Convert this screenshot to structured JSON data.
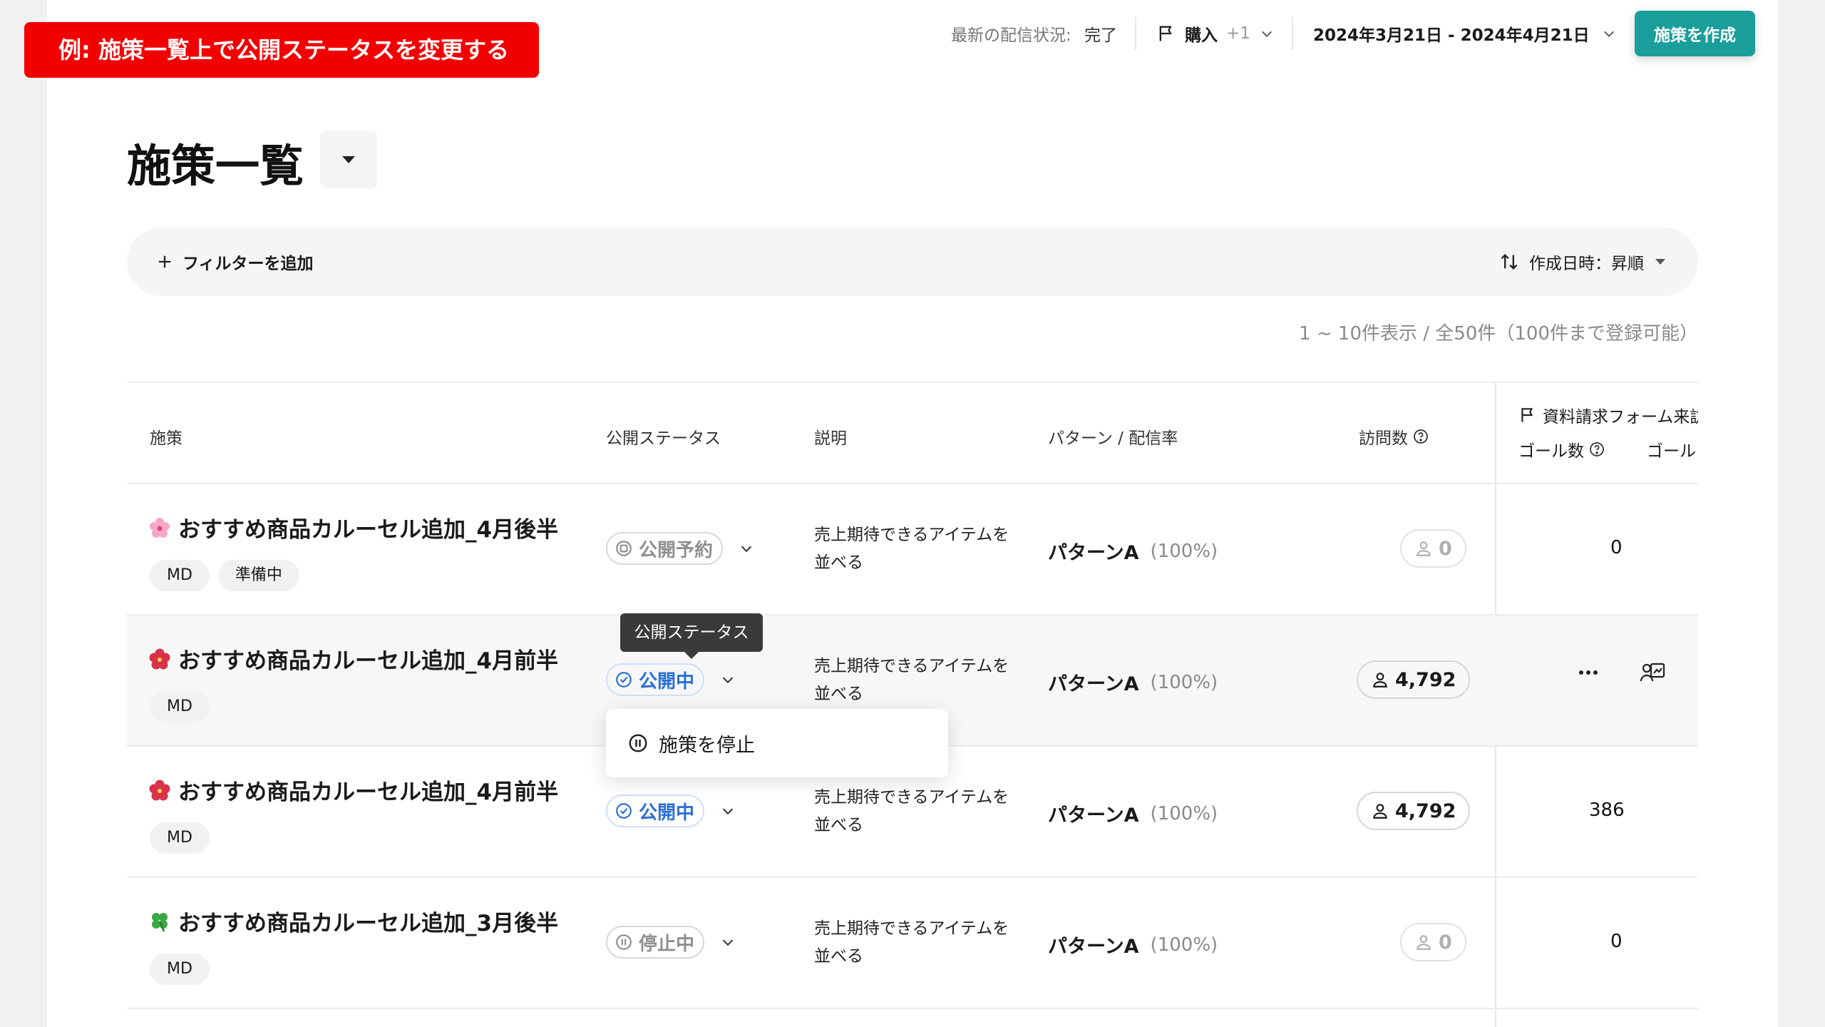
{
  "banner": {
    "text": "例: 施策一覧上で公開ステータスを変更する"
  },
  "header": {
    "delivery_label": "最新の配信状況:",
    "delivery_value": "完了",
    "goal_name": "購入",
    "goal_more": "+1",
    "date_range": "2024年3月21日 - 2024年4月21日",
    "create_label": "施策を作成"
  },
  "page": {
    "title": "施策一覧",
    "add_filter": "フィルターを追加",
    "sort_label": "作成日時：昇順",
    "count_text": "1 ~ 10件表示 / 全50件（100件まで登録可能）"
  },
  "columns": {
    "campaign": "施策",
    "status": "公開ステータス",
    "description": "説明",
    "pattern": "パターン / 配信率",
    "visits": "訪問数",
    "goal_title": "資料請求フォーム来訪",
    "goal_count": "ゴール数",
    "goal_rate": "ゴール"
  },
  "rows": [
    {
      "title": "おすすめ商品カルーセル追加_4月後半",
      "emoji": "cherry-blossom-icon",
      "tags": [
        "MD",
        "準備中"
      ],
      "status": "公開予約",
      "description": "売上期待できるアイテムを並べる",
      "pattern": "パターンA",
      "rate": "(100%)",
      "visits": "0",
      "goal": "0"
    },
    {
      "title": "おすすめ商品カルーセル追加_4月前半",
      "emoji": "hibiscus-icon",
      "tags": [
        "MD"
      ],
      "status": "公開中",
      "description": "売上期待できるアイテムを並べる",
      "pattern": "パターンA",
      "rate": "(100%)",
      "visits": "4,792",
      "goal": ""
    },
    {
      "title": "おすすめ商品カルーセル追加_4月前半",
      "emoji": "hibiscus-icon",
      "tags": [
        "MD"
      ],
      "status": "公開中",
      "description": "売上期待できるアイテムを並べる",
      "pattern": "パターンA",
      "rate": "(100%)",
      "visits": "4,792",
      "goal": "386"
    },
    {
      "title": "おすすめ商品カルーセル追加_3月後半",
      "emoji": "four-leaf-clover-icon",
      "tags": [
        "MD"
      ],
      "status": "停止中",
      "description": "売上期待できるアイテムを並べる",
      "pattern": "パターンA",
      "rate": "(100%)",
      "visits": "0",
      "goal": "0"
    }
  ],
  "tooltip": "公開ステータス",
  "menu": {
    "stop_label": "施策を停止"
  },
  "colors": {
    "accent": "#1a9e9b",
    "live": "#2b6fd6",
    "banner": "#f20000"
  }
}
